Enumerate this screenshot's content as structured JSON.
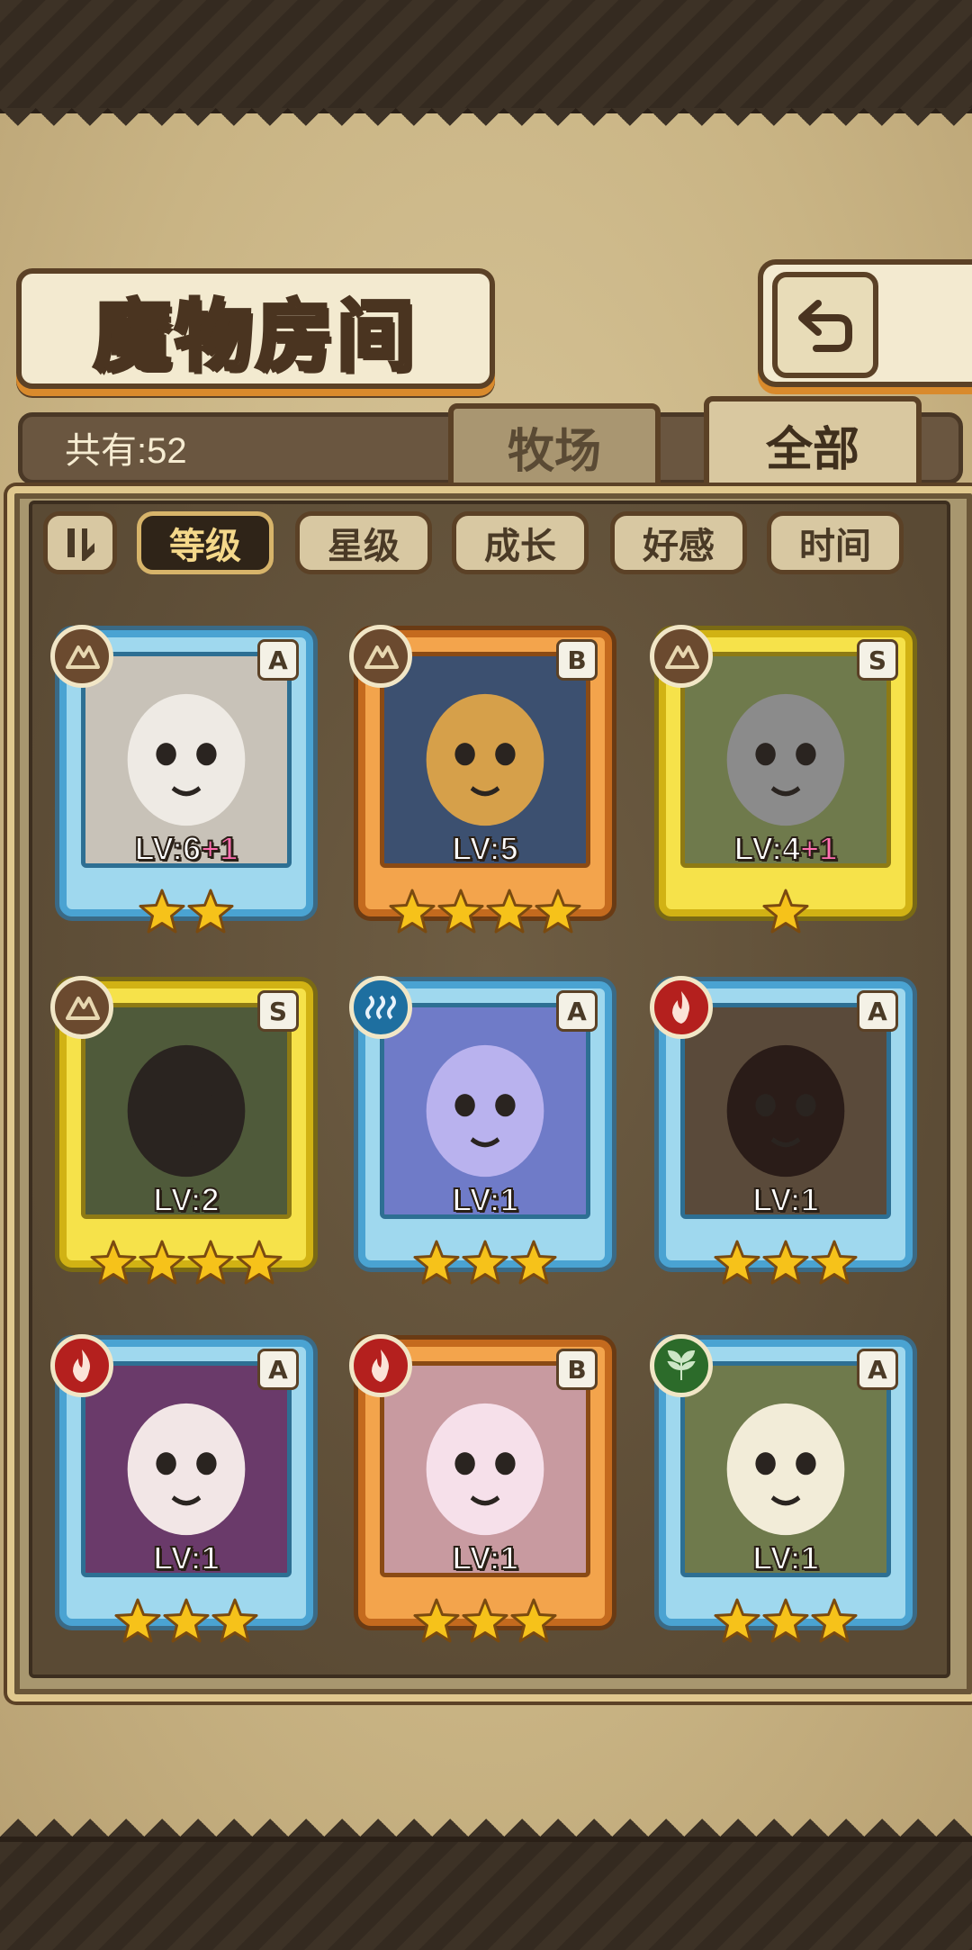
{
  "title": "魔物房间",
  "count_label": "共有:52",
  "tabs": {
    "farm": "牧场",
    "all": "全部"
  },
  "sort": {
    "level": "等级",
    "star": "星级",
    "growth": "成长",
    "affection": "好感",
    "time": "时间"
  },
  "cards": [
    {
      "rarity": "A",
      "element": "earth",
      "level": "LV:6",
      "bonus": "+1",
      "stars": 2
    },
    {
      "rarity": "B",
      "element": "earth",
      "level": "LV:5",
      "bonus": "",
      "stars": 4
    },
    {
      "rarity": "S",
      "element": "earth",
      "level": "LV:4",
      "bonus": "+1",
      "stars": 1
    },
    {
      "rarity": "S",
      "element": "earth",
      "level": "LV:2",
      "bonus": "",
      "stars": 4
    },
    {
      "rarity": "A",
      "element": "water",
      "level": "LV:1",
      "bonus": "",
      "stars": 3
    },
    {
      "rarity": "A",
      "element": "fire",
      "level": "LV:1",
      "bonus": "",
      "stars": 3
    },
    {
      "rarity": "A",
      "element": "fire",
      "level": "LV:1",
      "bonus": "",
      "stars": 3
    },
    {
      "rarity": "B",
      "element": "fire",
      "level": "LV:1",
      "bonus": "",
      "stars": 3
    },
    {
      "rarity": "A",
      "element": "wood",
      "level": "LV:1",
      "bonus": "",
      "stars": 3
    }
  ],
  "colors": {
    "star": "#f6c21a",
    "rarity_A": "#4aa3d2",
    "rarity_B": "#c46a1e",
    "rarity_S": "#d1b214"
  }
}
